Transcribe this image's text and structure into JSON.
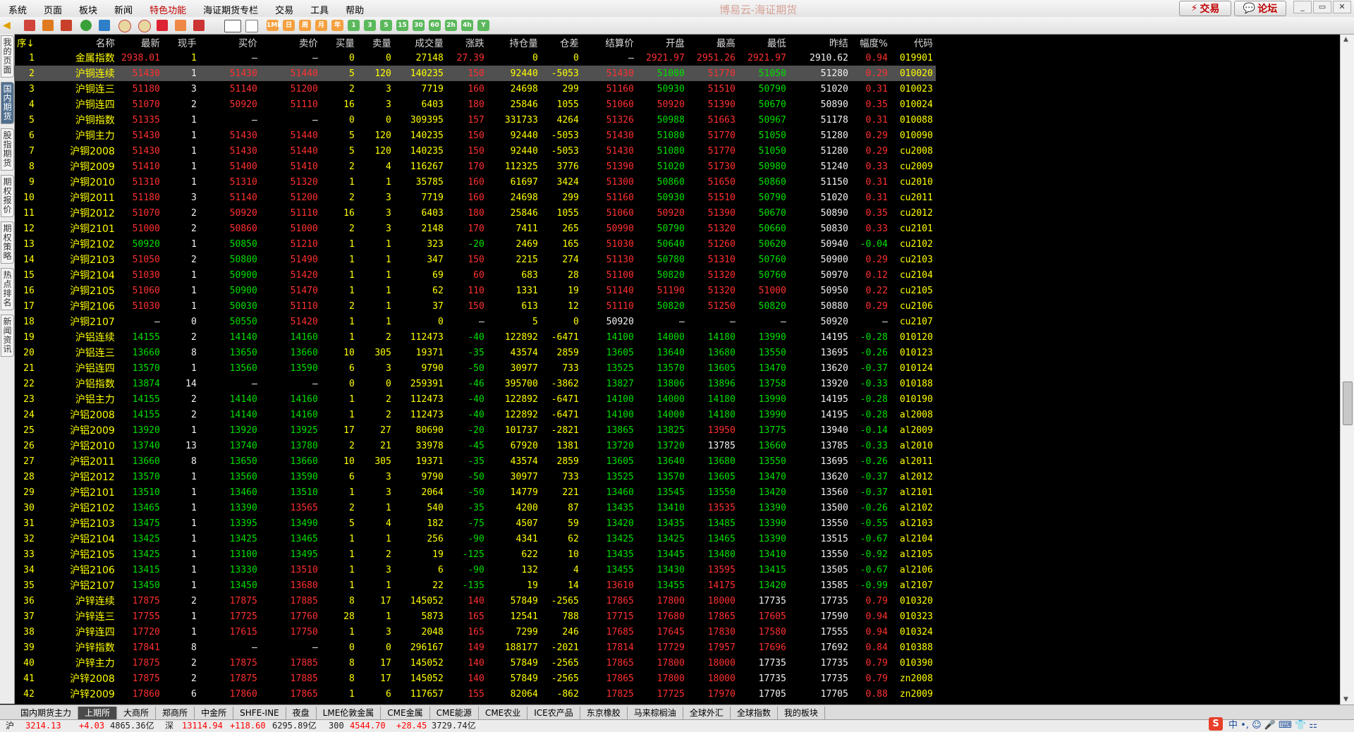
{
  "menu": [
    "系统",
    "页面",
    "板块",
    "新闻",
    "特色功能",
    "海证期货专栏",
    "交易",
    "工具",
    "帮助"
  ],
  "menu_active_index": 4,
  "window_title": "博易云-海证期货",
  "top_buttons": {
    "trade": "交易",
    "forum": "论坛"
  },
  "toolbar_period_buttons": [
    "1Mk",
    "日",
    "周",
    "月",
    "年",
    "1",
    "3",
    "5",
    "15",
    "30",
    "60",
    "2h",
    "4h",
    "Y"
  ],
  "left_tabs": [
    {
      "label": "我的页面",
      "active": false
    },
    {
      "label": "国内期货",
      "active": true
    },
    {
      "label": "股指期货",
      "active": false
    },
    {
      "label": "期权报价",
      "active": false
    },
    {
      "label": "期权策略",
      "active": false
    },
    {
      "label": "热点排名",
      "active": false
    },
    {
      "label": "新闻资讯",
      "active": false
    }
  ],
  "columns": [
    "序↓",
    "名称",
    "最新",
    "现手",
    "买价",
    "卖价",
    "买量",
    "卖量",
    "成交量",
    "涨跌",
    "持仓量",
    "仓差",
    "结算价",
    "开盘",
    "最高",
    "最低",
    "昨结",
    "幅度%",
    "代码"
  ],
  "column_colors": [
    "seq",
    "name",
    "",
    "w",
    "",
    "",
    "y",
    "y",
    "y",
    "",
    "y",
    "y",
    "",
    "",
    "",
    "",
    "w",
    "",
    ""
  ],
  "rows": [
    [
      "1",
      "金属指数",
      "2938.01",
      "1",
      "—",
      "—",
      "0",
      "0",
      "27148",
      "27.39",
      "0",
      "0",
      "—",
      "2921.97",
      "2951.26",
      "2921.97",
      "2910.62",
      "0.94",
      "019901"
    ],
    [
      "2",
      "沪铜连续",
      "51430",
      "1",
      "51430",
      "51440",
      "5",
      "120",
      "140235",
      "150",
      "92440",
      "-5053",
      "51430",
      "51080",
      "51770",
      "51050",
      "51280",
      "0.29",
      "010020"
    ],
    [
      "3",
      "沪铜连三",
      "51180",
      "3",
      "51140",
      "51200",
      "2",
      "3",
      "7719",
      "160",
      "24698",
      "299",
      "51160",
      "50930",
      "51510",
      "50790",
      "51020",
      "0.31",
      "010023"
    ],
    [
      "4",
      "沪铜连四",
      "51070",
      "2",
      "50920",
      "51110",
      "16",
      "3",
      "6403",
      "180",
      "25846",
      "1055",
      "51060",
      "50920",
      "51390",
      "50670",
      "50890",
      "0.35",
      "010024"
    ],
    [
      "5",
      "沪铜指数",
      "51335",
      "1",
      "—",
      "—",
      "0",
      "0",
      "309395",
      "157",
      "331733",
      "4264",
      "51326",
      "50988",
      "51663",
      "50967",
      "51178",
      "0.31",
      "010088"
    ],
    [
      "6",
      "沪铜主力",
      "51430",
      "1",
      "51430",
      "51440",
      "5",
      "120",
      "140235",
      "150",
      "92440",
      "-5053",
      "51430",
      "51080",
      "51770",
      "51050",
      "51280",
      "0.29",
      "010090"
    ],
    [
      "7",
      "沪铜2008",
      "51430",
      "1",
      "51430",
      "51440",
      "5",
      "120",
      "140235",
      "150",
      "92440",
      "-5053",
      "51430",
      "51080",
      "51770",
      "51050",
      "51280",
      "0.29",
      "cu2008"
    ],
    [
      "8",
      "沪铜2009",
      "51410",
      "1",
      "51400",
      "51410",
      "2",
      "4",
      "116267",
      "170",
      "112325",
      "3776",
      "51390",
      "51020",
      "51730",
      "50980",
      "51240",
      "0.33",
      "cu2009"
    ],
    [
      "9",
      "沪铜2010",
      "51310",
      "1",
      "51310",
      "51320",
      "1",
      "1",
      "35785",
      "160",
      "61697",
      "3424",
      "51300",
      "50860",
      "51650",
      "50860",
      "51150",
      "0.31",
      "cu2010"
    ],
    [
      "10",
      "沪铜2011",
      "51180",
      "3",
      "51140",
      "51200",
      "2",
      "3",
      "7719",
      "160",
      "24698",
      "299",
      "51160",
      "50930",
      "51510",
      "50790",
      "51020",
      "0.31",
      "cu2011"
    ],
    [
      "11",
      "沪铜2012",
      "51070",
      "2",
      "50920",
      "51110",
      "16",
      "3",
      "6403",
      "180",
      "25846",
      "1055",
      "51060",
      "50920",
      "51390",
      "50670",
      "50890",
      "0.35",
      "cu2012"
    ],
    [
      "12",
      "沪铜2101",
      "51000",
      "2",
      "50860",
      "51000",
      "2",
      "3",
      "2148",
      "170",
      "7411",
      "265",
      "50990",
      "50790",
      "51320",
      "50660",
      "50830",
      "0.33",
      "cu2101"
    ],
    [
      "13",
      "沪铜2102",
      "50920",
      "1",
      "50850",
      "51210",
      "1",
      "1",
      "323",
      "-20",
      "2469",
      "165",
      "51030",
      "50640",
      "51260",
      "50620",
      "50940",
      "-0.04",
      "cu2102"
    ],
    [
      "14",
      "沪铜2103",
      "51050",
      "2",
      "50800",
      "51490",
      "1",
      "1",
      "347",
      "150",
      "2215",
      "274",
      "51130",
      "50780",
      "51310",
      "50760",
      "50900",
      "0.29",
      "cu2103"
    ],
    [
      "15",
      "沪铜2104",
      "51030",
      "1",
      "50900",
      "51420",
      "1",
      "1",
      "69",
      "60",
      "683",
      "28",
      "51100",
      "50820",
      "51320",
      "50760",
      "50970",
      "0.12",
      "cu2104"
    ],
    [
      "16",
      "沪铜2105",
      "51060",
      "1",
      "50900",
      "51470",
      "1",
      "1",
      "62",
      "110",
      "1331",
      "19",
      "51140",
      "51190",
      "51320",
      "51000",
      "50950",
      "0.22",
      "cu2105"
    ],
    [
      "17",
      "沪铜2106",
      "51030",
      "1",
      "50030",
      "51110",
      "2",
      "1",
      "37",
      "150",
      "613",
      "12",
      "51110",
      "50820",
      "51250",
      "50820",
      "50880",
      "0.29",
      "cu2106"
    ],
    [
      "18",
      "沪铜2107",
      "—",
      "0",
      "50550",
      "51420",
      "1",
      "1",
      "0",
      "—",
      "5",
      "0",
      "50920",
      "—",
      "—",
      "—",
      "50920",
      "—",
      "cu2107"
    ],
    [
      "19",
      "沪铝连续",
      "14155",
      "2",
      "14140",
      "14160",
      "1",
      "2",
      "112473",
      "-40",
      "122892",
      "-6471",
      "14100",
      "14000",
      "14180",
      "13990",
      "14195",
      "-0.28",
      "010120"
    ],
    [
      "20",
      "沪铝连三",
      "13660",
      "8",
      "13650",
      "13660",
      "10",
      "305",
      "19371",
      "-35",
      "43574",
      "2859",
      "13605",
      "13640",
      "13680",
      "13550",
      "13695",
      "-0.26",
      "010123"
    ],
    [
      "21",
      "沪铝连四",
      "13570",
      "1",
      "13560",
      "13590",
      "6",
      "3",
      "9790",
      "-50",
      "30977",
      "733",
      "13525",
      "13570",
      "13605",
      "13470",
      "13620",
      "-0.37",
      "010124"
    ],
    [
      "22",
      "沪铝指数",
      "13874",
      "14",
      "—",
      "—",
      "0",
      "0",
      "259391",
      "-46",
      "395700",
      "-3862",
      "13827",
      "13806",
      "13896",
      "13758",
      "13920",
      "-0.33",
      "010188"
    ],
    [
      "23",
      "沪铝主力",
      "14155",
      "2",
      "14140",
      "14160",
      "1",
      "2",
      "112473",
      "-40",
      "122892",
      "-6471",
      "14100",
      "14000",
      "14180",
      "13990",
      "14195",
      "-0.28",
      "010190"
    ],
    [
      "24",
      "沪铝2008",
      "14155",
      "2",
      "14140",
      "14160",
      "1",
      "2",
      "112473",
      "-40",
      "122892",
      "-6471",
      "14100",
      "14000",
      "14180",
      "13990",
      "14195",
      "-0.28",
      "al2008"
    ],
    [
      "25",
      "沪铝2009",
      "13920",
      "1",
      "13920",
      "13925",
      "17",
      "27",
      "80690",
      "-20",
      "101737",
      "-2821",
      "13865",
      "13825",
      "13950",
      "13775",
      "13940",
      "-0.14",
      "al2009"
    ],
    [
      "26",
      "沪铝2010",
      "13740",
      "13",
      "13740",
      "13780",
      "2",
      "21",
      "33978",
      "-45",
      "67920",
      "1381",
      "13720",
      "13720",
      "13785",
      "13660",
      "13785",
      "-0.33",
      "al2010"
    ],
    [
      "27",
      "沪铝2011",
      "13660",
      "8",
      "13650",
      "13660",
      "10",
      "305",
      "19371",
      "-35",
      "43574",
      "2859",
      "13605",
      "13640",
      "13680",
      "13550",
      "13695",
      "-0.26",
      "al2011"
    ],
    [
      "28",
      "沪铝2012",
      "13570",
      "1",
      "13560",
      "13590",
      "6",
      "3",
      "9790",
      "-50",
      "30977",
      "733",
      "13525",
      "13570",
      "13605",
      "13470",
      "13620",
      "-0.37",
      "al2012"
    ],
    [
      "29",
      "沪铝2101",
      "13510",
      "1",
      "13460",
      "13510",
      "1",
      "3",
      "2064",
      "-50",
      "14779",
      "221",
      "13460",
      "13545",
      "13550",
      "13420",
      "13560",
      "-0.37",
      "al2101"
    ],
    [
      "30",
      "沪铝2102",
      "13465",
      "1",
      "13390",
      "13565",
      "2",
      "1",
      "540",
      "-35",
      "4200",
      "87",
      "13435",
      "13410",
      "13535",
      "13390",
      "13500",
      "-0.26",
      "al2102"
    ],
    [
      "31",
      "沪铝2103",
      "13475",
      "1",
      "13395",
      "13490",
      "5",
      "4",
      "182",
      "-75",
      "4507",
      "59",
      "13420",
      "13435",
      "13485",
      "13390",
      "13550",
      "-0.55",
      "al2103"
    ],
    [
      "32",
      "沪铝2104",
      "13425",
      "1",
      "13425",
      "13465",
      "1",
      "1",
      "256",
      "-90",
      "4341",
      "62",
      "13425",
      "13425",
      "13465",
      "13390",
      "13515",
      "-0.67",
      "al2104"
    ],
    [
      "33",
      "沪铝2105",
      "13425",
      "1",
      "13100",
      "13495",
      "1",
      "2",
      "19",
      "-125",
      "622",
      "10",
      "13435",
      "13445",
      "13480",
      "13410",
      "13550",
      "-0.92",
      "al2105"
    ],
    [
      "34",
      "沪铝2106",
      "13415",
      "1",
      "13330",
      "13510",
      "1",
      "3",
      "6",
      "-90",
      "132",
      "4",
      "13455",
      "13430",
      "13595",
      "13415",
      "13505",
      "-0.67",
      "al2106"
    ],
    [
      "35",
      "沪铝2107",
      "13450",
      "1",
      "13450",
      "13680",
      "1",
      "1",
      "22",
      "-135",
      "19",
      "14",
      "13610",
      "13455",
      "14175",
      "13420",
      "13585",
      "-0.99",
      "al2107"
    ],
    [
      "36",
      "沪锌连续",
      "17875",
      "2",
      "17875",
      "17885",
      "8",
      "17",
      "145052",
      "140",
      "57849",
      "-2565",
      "17865",
      "17800",
      "18000",
      "17735",
      "17735",
      "0.79",
      "010320"
    ],
    [
      "37",
      "沪锌连三",
      "17755",
      "1",
      "17725",
      "17760",
      "28",
      "1",
      "5873",
      "165",
      "12541",
      "788",
      "17715",
      "17680",
      "17865",
      "17605",
      "17590",
      "0.94",
      "010323"
    ],
    [
      "38",
      "沪锌连四",
      "17720",
      "1",
      "17615",
      "17750",
      "1",
      "3",
      "2048",
      "165",
      "7299",
      "246",
      "17685",
      "17645",
      "17830",
      "17580",
      "17555",
      "0.94",
      "010324"
    ],
    [
      "39",
      "沪锌指数",
      "17841",
      "8",
      "—",
      "—",
      "0",
      "0",
      "296167",
      "149",
      "188177",
      "-2021",
      "17814",
      "17729",
      "17957",
      "17696",
      "17692",
      "0.84",
      "010388"
    ],
    [
      "40",
      "沪锌主力",
      "17875",
      "2",
      "17875",
      "17885",
      "8",
      "17",
      "145052",
      "140",
      "57849",
      "-2565",
      "17865",
      "17800",
      "18000",
      "17735",
      "17735",
      "0.79",
      "010390"
    ],
    [
      "41",
      "沪锌2008",
      "17875",
      "2",
      "17875",
      "17885",
      "8",
      "17",
      "145052",
      "140",
      "57849",
      "-2565",
      "17865",
      "17800",
      "18000",
      "17735",
      "17735",
      "0.79",
      "zn2008"
    ],
    [
      "42",
      "沪锌2009",
      "17860",
      "6",
      "17860",
      "17865",
      "1",
      "6",
      "117657",
      "155",
      "82064",
      "-862",
      "17825",
      "17725",
      "17970",
      "17705",
      "17705",
      "0.88",
      "zn2009"
    ]
  ],
  "selected_row_index": 1,
  "exchange_tabs": [
    "国内期货主力",
    "上期所",
    "大商所",
    "郑商所",
    "中金所",
    "SHFE-INE",
    "夜盘",
    "LME伦敦金属",
    "CME金属",
    "CME能源",
    "CME农业",
    "ICE农产品",
    "东京橡胶",
    "马来棕榈油",
    "全球外汇",
    "全球指数",
    "我的板块"
  ],
  "exchange_tab_active_index": 1,
  "status": {
    "sh_label": "沪",
    "sh_value": "3214.13",
    "sh_change": "+4.03",
    "sh_amount": "4865.36亿",
    "sz_label": "深",
    "sz_value": "13114.94",
    "sz_change": "+118.60",
    "sz_amount": "6295.89亿",
    "hs300_label": "300",
    "hs300_value": "4544.70",
    "hs300_change": "+28.45",
    "hs300_amount": "3729.74亿"
  },
  "ime_text": "中 •, ☺ 🎤 ⌨ 👕 ⚏",
  "colors": {
    "up": "#ff3030",
    "down": "#00e000",
    "flat": "#f2f2f2",
    "yellow": "#ffff00",
    "cyan": "#00e5e5",
    "selected_row_bg": "#505050"
  }
}
